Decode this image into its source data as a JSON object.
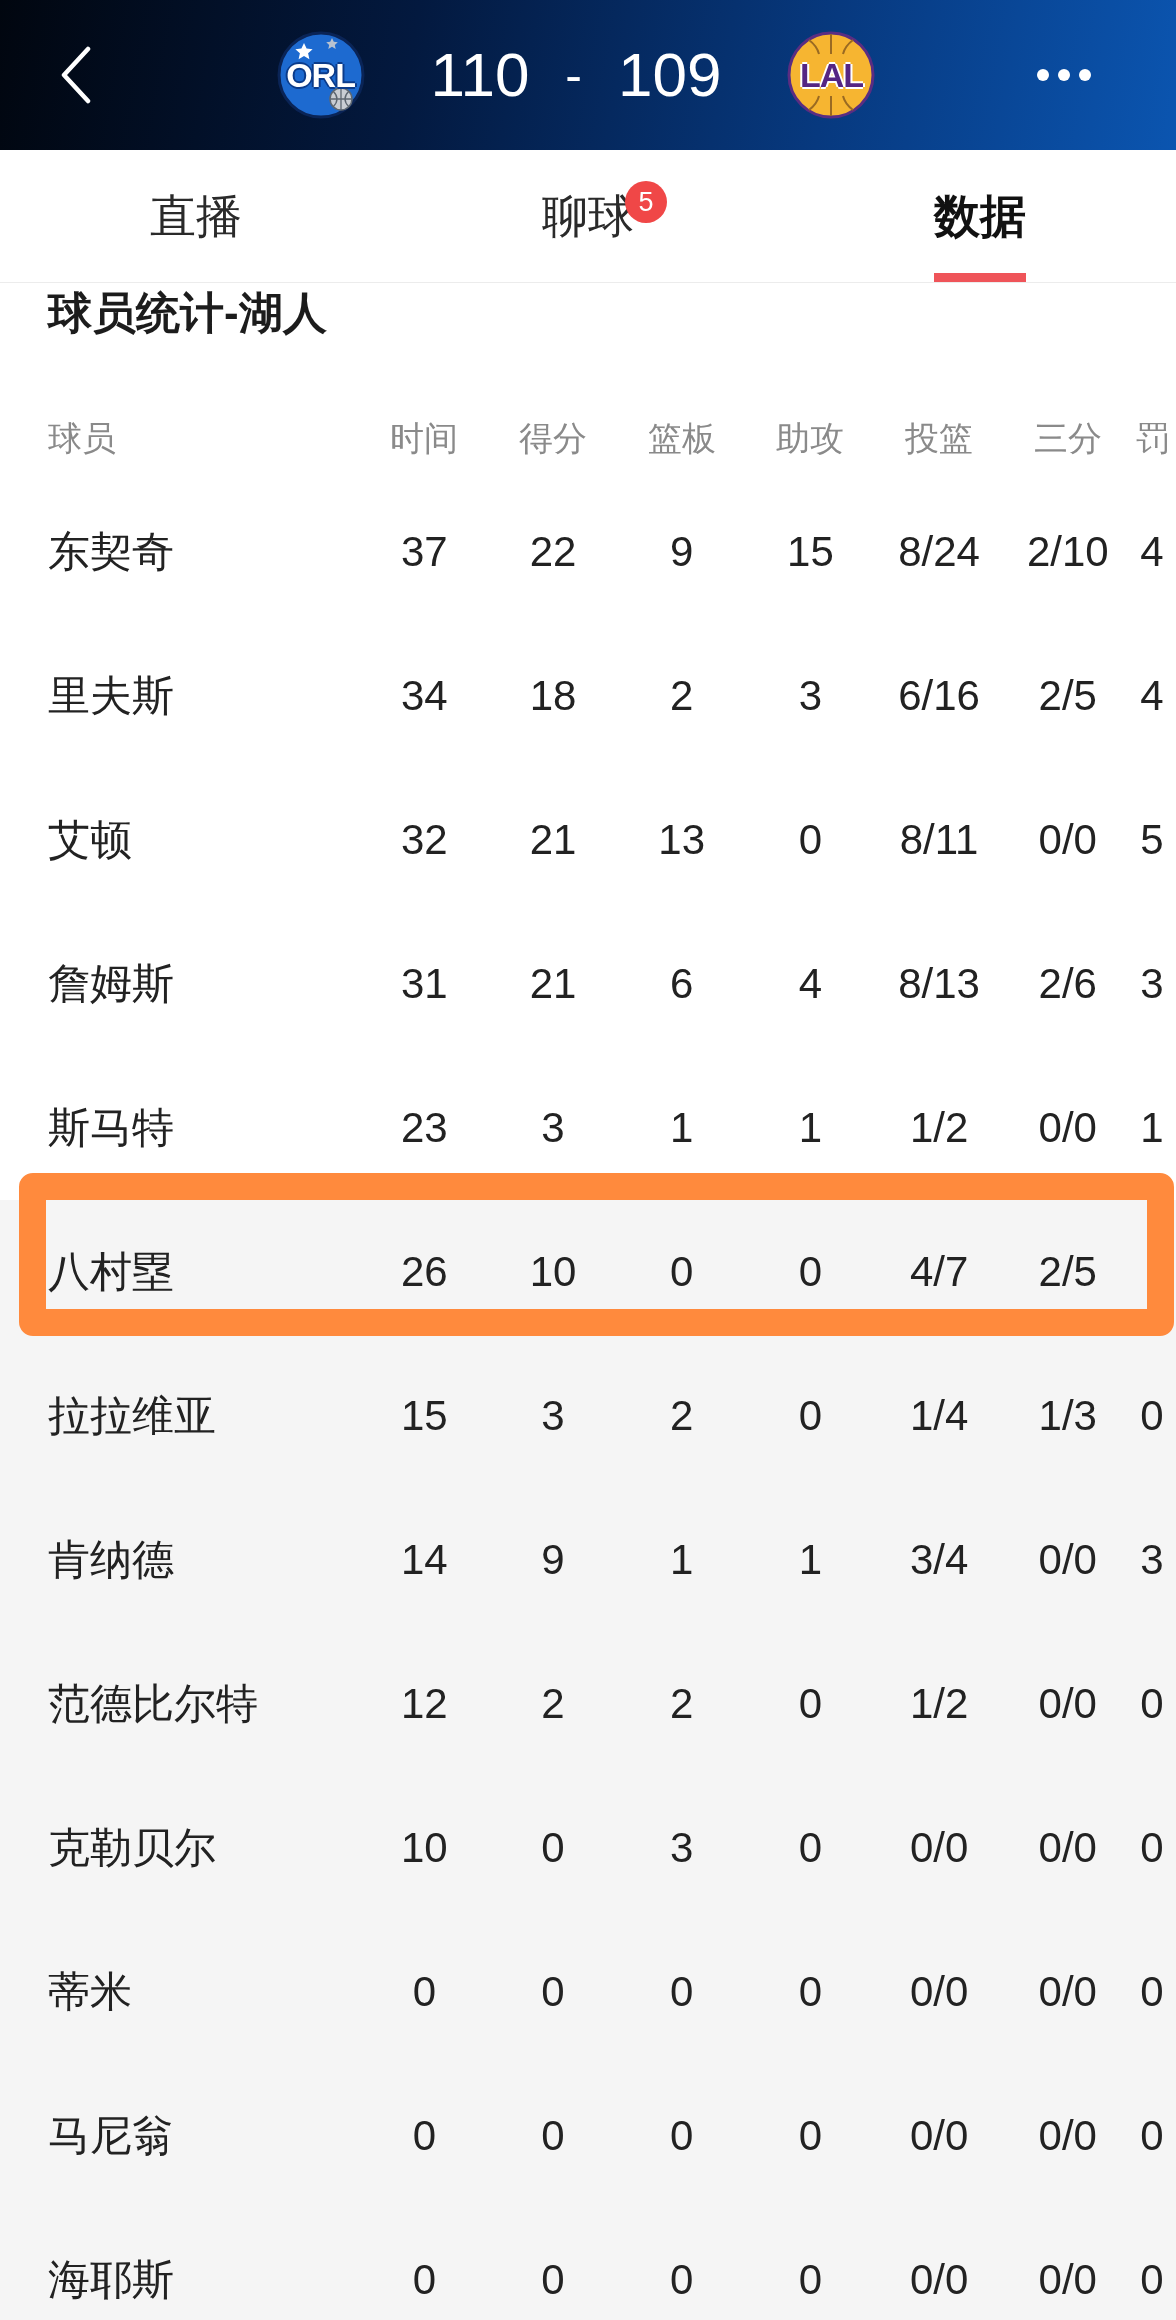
{
  "header": {
    "home_team": {
      "abbr": "ORL"
    },
    "home_score": "110",
    "separator": "-",
    "away_score": "109",
    "away_team": {
      "abbr": "LAL"
    }
  },
  "tabs": [
    {
      "label": "直播",
      "selected": false
    },
    {
      "label": "聊球",
      "selected": false,
      "badge": "5"
    },
    {
      "label": "数据",
      "selected": true
    }
  ],
  "section_title": "球员统计-湖人",
  "table": {
    "columns": [
      "球员",
      "时间",
      "得分",
      "篮板",
      "助攻",
      "投篮",
      "三分",
      "罚"
    ],
    "rows": [
      {
        "kind": "starter",
        "highlighted": false,
        "cells": [
          "东契奇",
          "37",
          "22",
          "9",
          "15",
          "8/24",
          "2/10",
          "4"
        ]
      },
      {
        "kind": "starter",
        "highlighted": false,
        "cells": [
          "里夫斯",
          "34",
          "18",
          "2",
          "3",
          "6/16",
          "2/5",
          "4"
        ]
      },
      {
        "kind": "starter",
        "highlighted": false,
        "cells": [
          "艾顿",
          "32",
          "21",
          "13",
          "0",
          "8/11",
          "0/0",
          "5"
        ]
      },
      {
        "kind": "starter",
        "highlighted": false,
        "cells": [
          "詹姆斯",
          "31",
          "21",
          "6",
          "4",
          "8/13",
          "2/6",
          "3"
        ]
      },
      {
        "kind": "starter",
        "highlighted": false,
        "cells": [
          "斯马特",
          "23",
          "3",
          "1",
          "1",
          "1/2",
          "0/0",
          "1"
        ]
      },
      {
        "kind": "bench",
        "highlighted": true,
        "cells": [
          "八村塁",
          "26",
          "10",
          "0",
          "0",
          "4/7",
          "2/5"
        ]
      },
      {
        "kind": "bench",
        "highlighted": false,
        "cells": [
          "拉拉维亚",
          "15",
          "3",
          "2",
          "0",
          "1/4",
          "1/3",
          "0"
        ]
      },
      {
        "kind": "bench",
        "highlighted": false,
        "cells": [
          "肯纳德",
          "14",
          "9",
          "1",
          "1",
          "3/4",
          "0/0",
          "3"
        ]
      },
      {
        "kind": "bench",
        "highlighted": false,
        "cells": [
          "范德比尔特",
          "12",
          "2",
          "2",
          "0",
          "1/2",
          "0/0",
          "0"
        ]
      },
      {
        "kind": "bench",
        "highlighted": false,
        "cells": [
          "克勒贝尔",
          "10",
          "0",
          "3",
          "0",
          "0/0",
          "0/0",
          "0"
        ]
      },
      {
        "kind": "bench",
        "highlighted": false,
        "cells": [
          "蒂米",
          "0",
          "0",
          "0",
          "0",
          "0/0",
          "0/0",
          "0"
        ]
      },
      {
        "kind": "bench",
        "highlighted": false,
        "cells": [
          "马尼翁",
          "0",
          "0",
          "0",
          "0",
          "0/0",
          "0/0",
          "0"
        ]
      },
      {
        "kind": "bench",
        "highlighted": false,
        "cells": [
          "海耶斯",
          "0",
          "0",
          "0",
          "0",
          "0/0",
          "0/0",
          "0"
        ]
      }
    ]
  }
}
